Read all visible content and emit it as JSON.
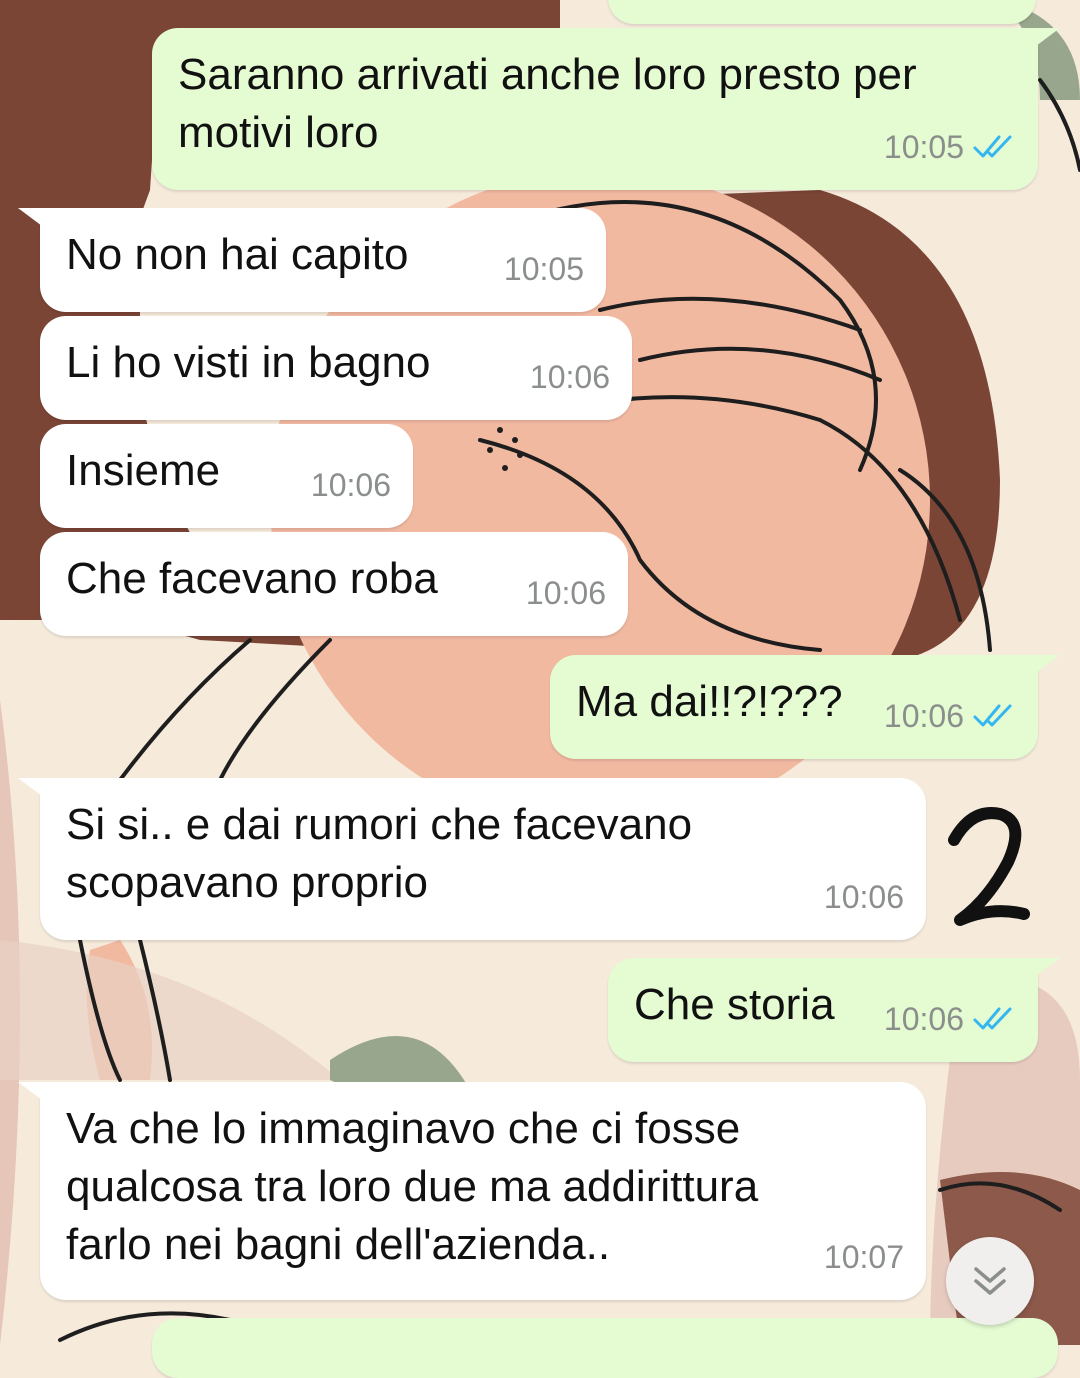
{
  "theme": {
    "incoming_bubble": "#ffffff",
    "outgoing_bubble": "#e5fbd2",
    "read_ticks": "#34b7f1",
    "timestamp": "#8b8f8c"
  },
  "messages": [
    {
      "direction": "out",
      "text_lines": [
        "Saranno arrivati anche loro presto per",
        "motivi loro"
      ],
      "time": "10:05",
      "status": "read"
    },
    {
      "direction": "in",
      "text_lines": [
        "No non hai capito"
      ],
      "time": "10:05"
    },
    {
      "direction": "in",
      "text_lines": [
        "Li ho visti in bagno"
      ],
      "time": "10:06"
    },
    {
      "direction": "in",
      "text_lines": [
        "Insieme"
      ],
      "time": "10:06"
    },
    {
      "direction": "in",
      "text_lines": [
        "Che facevano roba"
      ],
      "time": "10:06"
    },
    {
      "direction": "out",
      "text_lines": [
        "Ma dai!!?!???"
      ],
      "time": "10:06",
      "status": "read"
    },
    {
      "direction": "in",
      "text_lines": [
        "Si si.. e dai rumori che facevano",
        "scopavano proprio"
      ],
      "time": "10:06"
    },
    {
      "direction": "out",
      "text_lines": [
        "Che storia"
      ],
      "time": "10:06",
      "status": "read"
    },
    {
      "direction": "in",
      "text_lines": [
        "Va che lo immaginavo che ci fosse",
        "qualcosa tra loro due ma addirittura",
        "farlo nei bagni dell'azienda.."
      ],
      "time": "10:07"
    }
  ],
  "annotation_mark": "2",
  "scroll_button_icon": "double-chevron-down-icon"
}
